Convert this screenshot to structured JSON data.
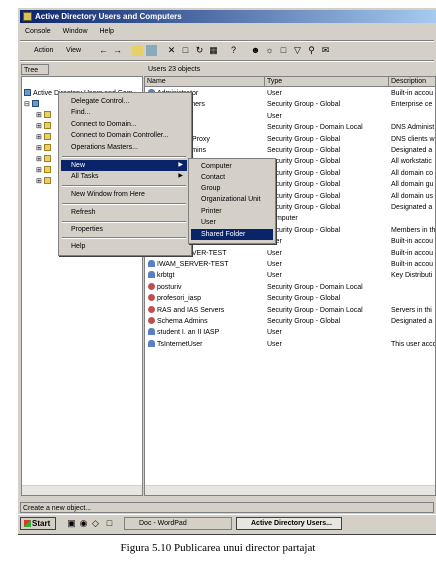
{
  "window": {
    "title": "Active Directory Users and Computers"
  },
  "menubar": {
    "items": [
      "Console",
      "Window",
      "Help"
    ]
  },
  "toolbar": {
    "action_label": "Action",
    "view_label": "View"
  },
  "tree": {
    "tab_label": "Tree",
    "root_label": "Active Directory Users and Com"
  },
  "list": {
    "header": "Users   23 objects",
    "columns": [
      "Name",
      "Type",
      "Description"
    ],
    "rows": [
      {
        "name": "Administrator",
        "type": "User",
        "desc": "Built-in accou",
        "icon": "user-icon"
      },
      {
        "name": "Cert Publishers",
        "type": "Security Group - Global",
        "desc": "Enterprise ce",
        "icon": "group-icon"
      },
      {
        "name": "",
        "type": "User",
        "desc": "",
        "icon": "user-icon"
      },
      {
        "name": "DnsAdmins",
        "type": "Security Group - Domain Local",
        "desc": "DNS Administ",
        "icon": "group-icon"
      },
      {
        "name": "DnsUpdateProxy",
        "type": "Security Group - Global",
        "desc": "DNS clients w",
        "icon": "group-icon"
      },
      {
        "name": "Domain Admins",
        "type": "Security Group - Global",
        "desc": "Designated a",
        "icon": "group-icon"
      },
      {
        "name": "",
        "type": "Security Group - Global",
        "desc": "All workstatic",
        "icon": "group-icon"
      },
      {
        "name": "",
        "type": "Security Group - Global",
        "desc": "All domain co",
        "icon": "group-icon"
      },
      {
        "name": "",
        "type": "Security Group - Global",
        "desc": "All domain gu",
        "icon": "group-icon"
      },
      {
        "name": "",
        "type": "Security Group - Global",
        "desc": "All domain us",
        "icon": "group-icon"
      },
      {
        "name": "",
        "type": "Security Group - Global",
        "desc": "Designated a",
        "icon": "group-icon"
      },
      {
        "name": "",
        "type": "Computer",
        "desc": "",
        "icon": "computer-icon"
      },
      {
        "name": "",
        "type": "Security Group - Global",
        "desc": "Members in th",
        "icon": "group-icon"
      },
      {
        "name": "",
        "type": "User",
        "desc": "Built-in accou",
        "icon": "user-icon"
      },
      {
        "name": "IUSR_SERVER-TEST",
        "type": "User",
        "desc": "Built-in accou",
        "icon": "user-icon"
      },
      {
        "name": "IWAM_SERVER-TEST",
        "type": "User",
        "desc": "Built-in accou",
        "icon": "user-icon"
      },
      {
        "name": "krbtgt",
        "type": "User",
        "desc": "Key Distributi",
        "icon": "user-icon"
      },
      {
        "name": "posturiv",
        "type": "Security Group - Domain Local",
        "desc": "",
        "icon": "group-icon"
      },
      {
        "name": "profesori_iasp",
        "type": "Security Group - Global",
        "desc": "",
        "icon": "group-icon"
      },
      {
        "name": "RAS and IAS Servers",
        "type": "Security Group - Domain Local",
        "desc": "Servers in thi",
        "icon": "group-icon"
      },
      {
        "name": "Schema Admins",
        "type": "Security Group - Global",
        "desc": "Designated a",
        "icon": "group-icon"
      },
      {
        "name": "student I. an II IASP",
        "type": "User",
        "desc": "",
        "icon": "user-icon"
      },
      {
        "name": "TsInternetUser",
        "type": "User",
        "desc": "This user acco",
        "icon": "user-icon"
      }
    ]
  },
  "context_menu": {
    "items": [
      "Delegate Control...",
      "Find...",
      "Connect to Domain...",
      "Connect to Domain Controller...",
      "Operations Masters...",
      "New",
      "All Tasks",
      "New Window from Here",
      "Refresh",
      "Properties",
      "Help"
    ]
  },
  "submenu": {
    "items": [
      "Computer",
      "Contact",
      "Group",
      "Organizational Unit",
      "Printer",
      "User",
      "Shared Folder"
    ],
    "highlighted": "Shared Folder"
  },
  "statusbar": {
    "text": "Create a new object..."
  },
  "taskbar": {
    "start_label": "Start",
    "tasks": [
      {
        "label": "Doc - WordPad",
        "active": false
      },
      {
        "label": "Active Directory Users...",
        "active": true
      }
    ]
  },
  "caption": "Figura 5.10 Publicarea unui director partajat",
  "colors": {
    "title_bar": "#0a246a",
    "highlight": "#0a246a",
    "chrome": "#d4d0c8"
  }
}
